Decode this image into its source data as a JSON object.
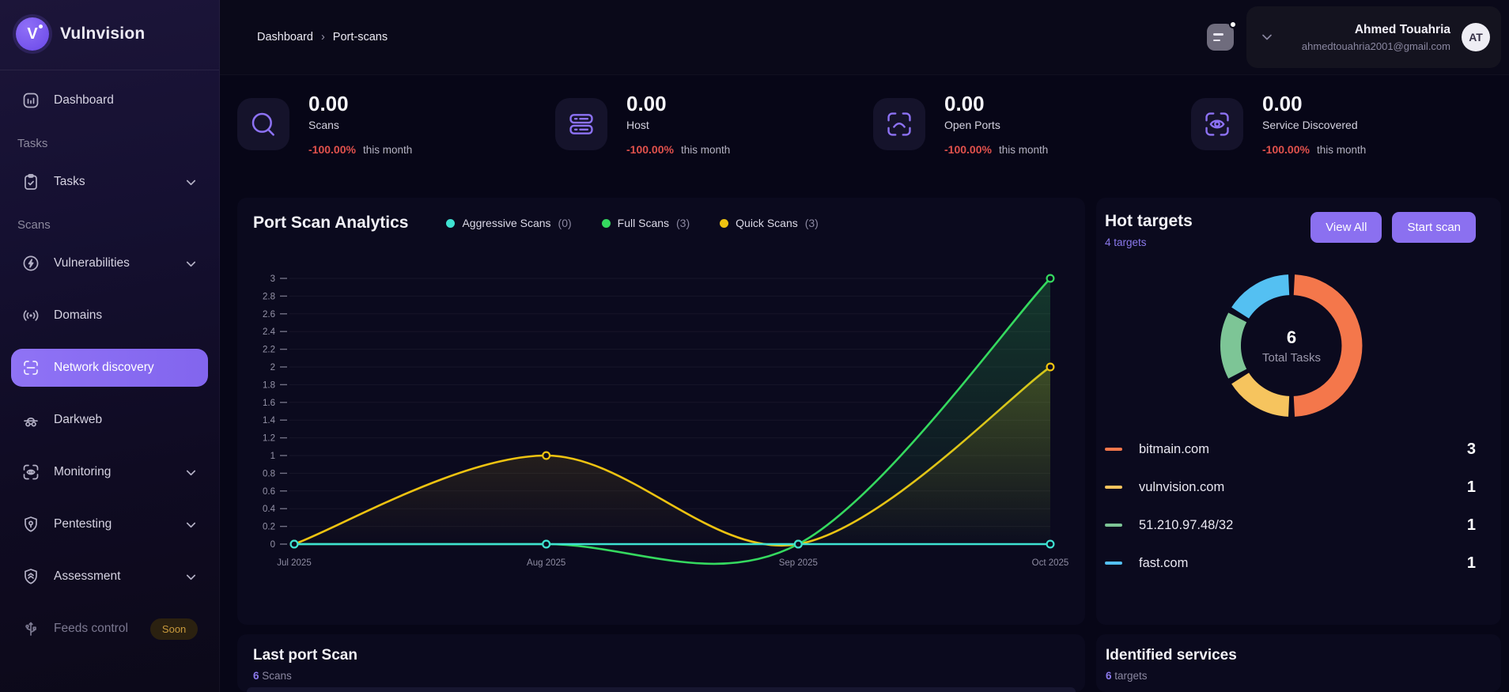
{
  "app": {
    "name": "Vulnvision"
  },
  "topbar": {
    "breadcrumb": {
      "items": [
        "Dashboard",
        "Port-scans"
      ],
      "separator": "›"
    },
    "user": {
      "name": "Ahmed Touahria",
      "email": "ahmedtouahria2001@gmail.com",
      "initials": "AT"
    }
  },
  "sidebar": {
    "items": [
      {
        "type": "item",
        "label": "Dashboard",
        "icon": "dashboard-icon"
      },
      {
        "type": "section",
        "label": "Tasks"
      },
      {
        "type": "item",
        "label": "Tasks",
        "icon": "tasks-icon",
        "chevron": true
      },
      {
        "type": "section",
        "label": "Scans"
      },
      {
        "type": "item",
        "label": "Vulnerabilities",
        "icon": "vulnerabilities-icon",
        "chevron": true
      },
      {
        "type": "item",
        "label": "Domains",
        "icon": "domains-icon"
      },
      {
        "type": "item",
        "label": "Network discovery",
        "icon": "network-discovery-icon",
        "active": true
      },
      {
        "type": "item",
        "label": "Darkweb",
        "icon": "darkweb-icon"
      },
      {
        "type": "item",
        "label": "Monitoring",
        "icon": "monitoring-icon",
        "chevron": true
      },
      {
        "type": "item",
        "label": "Pentesting",
        "icon": "pentesting-icon",
        "chevron": true
      },
      {
        "type": "item",
        "label": "Assessment",
        "icon": "assessment-icon",
        "chevron": true
      },
      {
        "type": "item",
        "label": "Feeds control",
        "icon": "feeds-icon",
        "badge": "Soon",
        "disabled": true
      }
    ]
  },
  "stats": [
    {
      "value": "0.00",
      "label": "Scans",
      "change": "-100.00%",
      "period": "this month",
      "icon": "search-icon"
    },
    {
      "value": "0.00",
      "label": "Host",
      "change": "-100.00%",
      "period": "this month",
      "icon": "host-icon"
    },
    {
      "value": "0.00",
      "label": "Open Ports",
      "change": "-100.00%",
      "period": "this month",
      "icon": "open-ports-icon"
    },
    {
      "value": "0.00",
      "label": "Service Discovered",
      "change": "-100.00%",
      "period": "this month",
      "icon": "eye-scan-icon"
    }
  ],
  "analytics": {
    "title": "Port Scan Analytics"
  },
  "hot_targets": {
    "title": "Hot targets",
    "subtitle": "4 targets",
    "view_all_label": "View All",
    "start_scan_label": "Start scan"
  },
  "bottom": {
    "last_scan": {
      "title": "Last port Scan",
      "count": "6",
      "unit": "Scans"
    },
    "services": {
      "title": "Identified services",
      "count": "6",
      "unit": "targets"
    }
  },
  "colors": {
    "accent_purple": "#8b70f0",
    "negative_red": "#e0514c",
    "soon_gold": "#c99a3d"
  },
  "chart_data": [
    {
      "type": "line",
      "title": "Port Scan Analytics",
      "x": [
        "Jul 2025",
        "Aug 2025",
        "Sep 2025",
        "Oct 2025"
      ],
      "series": [
        {
          "name": "Aggressive Scans",
          "count": 0,
          "color": "#3fe2d2",
          "values": [
            0,
            0,
            0,
            0
          ]
        },
        {
          "name": "Full Scans",
          "count": 3,
          "color": "#35d95f",
          "values": [
            0,
            0,
            0,
            3
          ]
        },
        {
          "name": "Quick Scans",
          "count": 3,
          "color": "#eec311",
          "values": [
            0,
            1,
            0,
            2
          ]
        }
      ],
      "ylim": [
        0,
        3
      ],
      "ytick_step": 0.2,
      "grid": true,
      "smooth": true,
      "legend_position": "top"
    },
    {
      "type": "donut",
      "center_value": "6",
      "center_label": "Total Tasks",
      "slices": [
        {
          "label": "bitmain.com",
          "value": 3,
          "color": "#f4774b"
        },
        {
          "label": "vulnvision.com",
          "value": 1,
          "color": "#f6c45e"
        },
        {
          "label": "51.210.97.48/32",
          "value": 1,
          "color": "#7dc596"
        },
        {
          "label": "fast.com",
          "value": 1,
          "color": "#54c0f2"
        }
      ]
    }
  ]
}
